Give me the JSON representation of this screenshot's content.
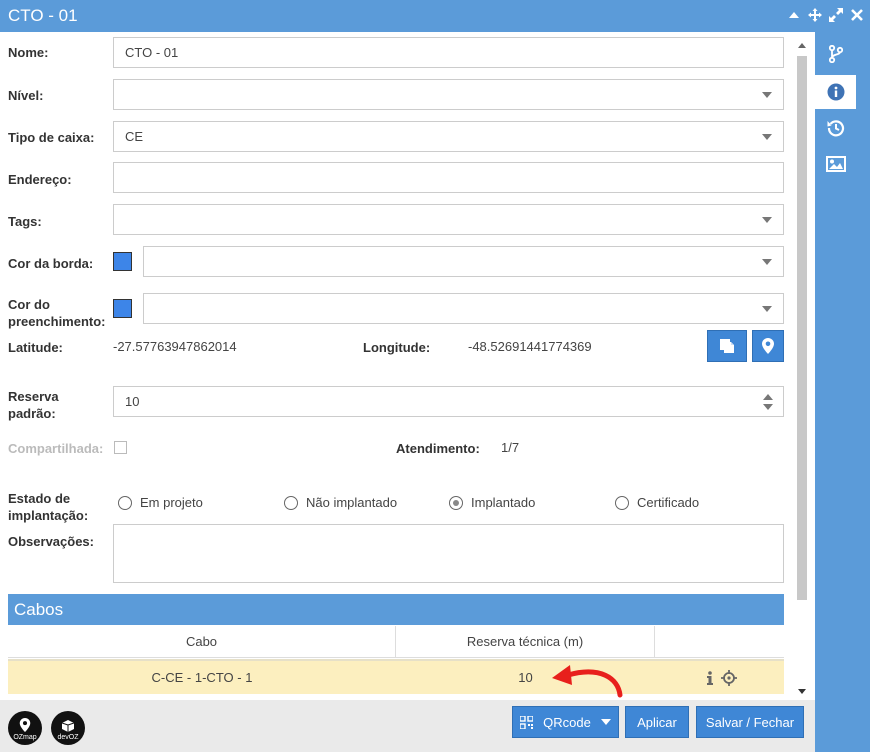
{
  "window": {
    "title": "CTO - 01"
  },
  "form": {
    "nome": {
      "label": "Nome:",
      "value": "CTO - 01"
    },
    "nivel": {
      "label": "Nível:",
      "value": ""
    },
    "tipo_caixa": {
      "label": "Tipo de caixa:",
      "value": "CE"
    },
    "endereco": {
      "label": "Endereço:",
      "value": ""
    },
    "tags": {
      "label": "Tags:",
      "value": ""
    },
    "cor_borda": {
      "label": "Cor da borda:",
      "color": "#3d85e8",
      "value": ""
    },
    "cor_preenchimento": {
      "label_line1": "Cor do",
      "label_line2": "preenchimento:",
      "color": "#3d85e8",
      "value": ""
    },
    "latitude": {
      "label": "Latitude:",
      "value": "-27.57763947862014"
    },
    "longitude": {
      "label": "Longitude:",
      "value": "-48.52691441774369"
    },
    "reserva": {
      "label_line1": "Reserva",
      "label_line2": "padrão:",
      "value": "10"
    },
    "compartilhada": {
      "label": "Compartilhada:",
      "checked": false
    },
    "atendimento": {
      "label": "Atendimento:",
      "value": "1/7"
    },
    "estado": {
      "label_line1": "Estado de",
      "label_line2": "implantação:",
      "options": [
        "Em projeto",
        "Não implantado",
        "Implantado",
        "Certificado"
      ],
      "selected": "Implantado"
    },
    "observacoes": {
      "label": "Observações:",
      "value": ""
    }
  },
  "cabos": {
    "title": "Cabos",
    "columns": [
      "Cabo",
      "Reserva técnica (m)",
      ""
    ],
    "rows": [
      {
        "cabo": "C-CE - 1-CTO - 1",
        "reserva": "10"
      }
    ]
  },
  "footer": {
    "qrcode_label": "QRcode",
    "aplicar_label": "Aplicar",
    "salvar_label": "Salvar / Fechar",
    "logo1_text": "OZmap",
    "logo2_text": "devOZ"
  },
  "colors": {
    "accent": "#5b9bd9",
    "button": "#3f87d6",
    "highlight_row": "#fcefbf",
    "annotation_arrow": "#e8201c"
  }
}
